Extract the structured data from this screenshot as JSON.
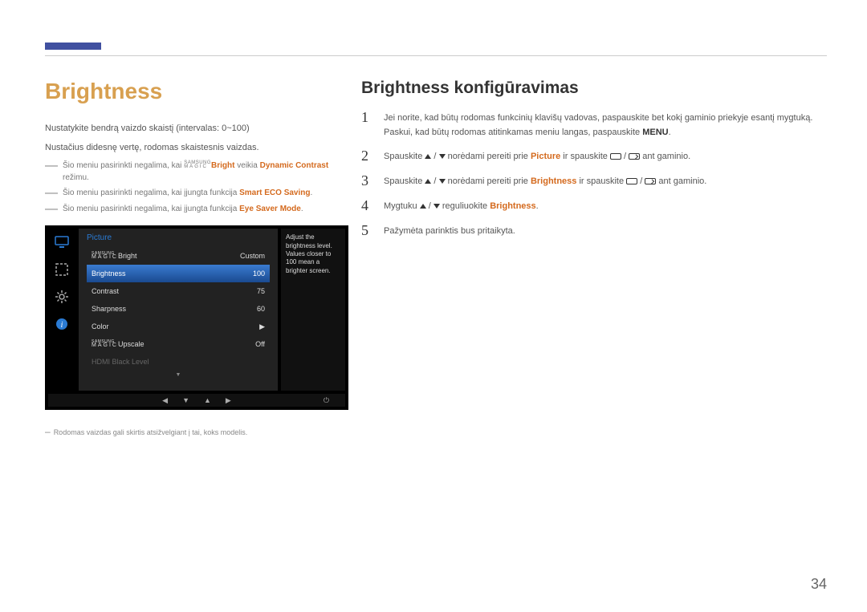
{
  "page_number": "34",
  "left": {
    "heading": "Brightness",
    "p1": "Nustatykite bendrą vaizdo skaistį (intervalas: 0~100)",
    "p2": "Nustačius didesnę vertę, rodomas skaistesnis vaizdas.",
    "note1_pre": "Šio meniu pasirinkti negalima, kai ",
    "note1_magic_top": "SAMSUNG",
    "note1_magic_bot": "MAGIC",
    "note1_bright": "Bright",
    "note1_mid": " veikia ",
    "note1_dc": "Dynamic Contrast",
    "note1_post": " režimu.",
    "note2_pre": "Šio meniu pasirinkti negalima, kai įjungta funkcija ",
    "note2_em": "Smart ECO Saving",
    "note2_post": ".",
    "note3_pre": "Šio meniu pasirinkti negalima, kai įjungta funkcija ",
    "note3_em": "Eye Saver Mode",
    "note3_post": ".",
    "footnote": "Rodomas vaizdas gali skirtis atsižvelgiant į tai, koks modelis."
  },
  "osd": {
    "title": "Picture",
    "row_magicbright_label": "Bright",
    "row_magicbright_value": "Custom",
    "row_brightness_label": "Brightness",
    "row_brightness_value": "100",
    "row_contrast_label": "Contrast",
    "row_contrast_value": "75",
    "row_sharpness_label": "Sharpness",
    "row_sharpness_value": "60",
    "row_color_label": "Color",
    "row_color_value": "▶",
    "row_upscale_label": "Upscale",
    "row_upscale_value": "Off",
    "row_hdmi_label": "HDMI Black Level",
    "desc": "Adjust the brightness level. Values closer to 100 mean a brighter screen.",
    "magic_sam": "SAMSUNG",
    "magic_mag": "MAGIC"
  },
  "right": {
    "heading": "Brightness konfigūravimas",
    "s1a": "Jei norite, kad būtų rodomas funkcinių klavišų vadovas, paspauskite bet kokį gaminio priekyje esantį mygtuką. Paskui, kad būtų rodomas atitinkamas meniu langas, paspauskite ",
    "s1_menu": "MENU",
    "s1b": ".",
    "s2a": "Spauskite ",
    "s2b": " norėdami pereiti prie ",
    "s2_pic": "Picture",
    "s2c": " ir spauskite ",
    "s2d": " ant gaminio.",
    "s3a": "Spauskite ",
    "s3b": " norėdami pereiti prie ",
    "s3_br": "Brightness",
    "s3c": " ir spauskite ",
    "s3d": " ant gaminio.",
    "s4a": "Mygtuku ",
    "s4b": " reguliuokite ",
    "s4_br": "Brightness",
    "s4c": ".",
    "s5": "Pažymėta parinktis bus pritaikyta."
  }
}
